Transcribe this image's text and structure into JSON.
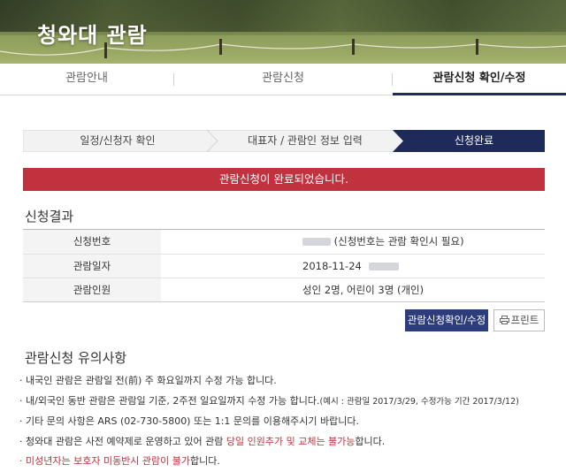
{
  "hero": {
    "title": "청와대 관람"
  },
  "tabs": [
    {
      "label": "관람안내"
    },
    {
      "label": "관람신청"
    },
    {
      "label": "관람신청 확인/수정"
    }
  ],
  "steps": [
    {
      "label": "일정/신청자 확인"
    },
    {
      "label": "대표자 / 관람인 정보 입력"
    },
    {
      "label": "신청완료"
    }
  ],
  "banner": {
    "message": "관람신청이 완료되었습니다."
  },
  "result": {
    "title": "신청결과",
    "rows": [
      {
        "label": "신청번호",
        "value": "(신청번호는 관람 확인시 필요)"
      },
      {
        "label": "관람일자",
        "value": "2018-11-24"
      },
      {
        "label": "관람인원",
        "value": "성인 2명, 어린이 3명 (개인)"
      }
    ]
  },
  "buttons": {
    "confirm": "관람신청확인/수정",
    "print": "프린트"
  },
  "notes": {
    "title": "관람신청 유의사항",
    "items": [
      {
        "text": "· 내국인 관람은 관람일 전(前) 주 화요일까지 수정 가능 합니다."
      },
      {
        "text": "· 내/외국인 동반 관람은 관람일 기준, 2주전 일요일까지 수정 가능 합니다.",
        "small": "(예시 : 관람일 2017/3/29, 수정가능 기간 2017/3/12)"
      },
      {
        "text": "· 기타 문의 사항은 ARS (02-730-5800) 또는 1:1 문의를 이용해주시기 바랍니다."
      },
      {
        "pre": "· 청와대 관람은 사전 예약제로 운영하고 있어 관람 ",
        "red": "당일 인원추가 및 교체는 불가능",
        "post": "합니다."
      },
      {
        "red": "· 미성년자는 보호자 미동반시 관람이 불가",
        "post": "합니다."
      }
    ]
  },
  "colors": {
    "primary": "#2d3d7c",
    "active_step": "#1e2a5a",
    "alert": "#c0323e"
  }
}
